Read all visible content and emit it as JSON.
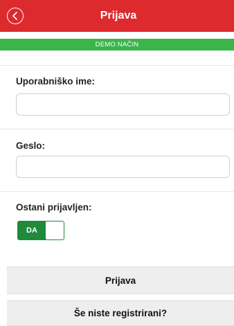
{
  "header": {
    "title": "Prijava",
    "color": "#dd2a2e"
  },
  "demo_bar": {
    "label": "DEMO NAČIN",
    "color": "#3bb54a"
  },
  "form": {
    "username_label": "Uporabniško ime:",
    "username_value": "",
    "password_label": "Geslo:",
    "password_value": "",
    "remember_label": "Ostani prijavljen:",
    "remember_toggle_label": "DA",
    "remember_on": true
  },
  "buttons": {
    "login_label": "Prijava",
    "register_label": "Še niste registrirani?"
  },
  "icons": {
    "back": "chevron-left-circle-icon"
  }
}
